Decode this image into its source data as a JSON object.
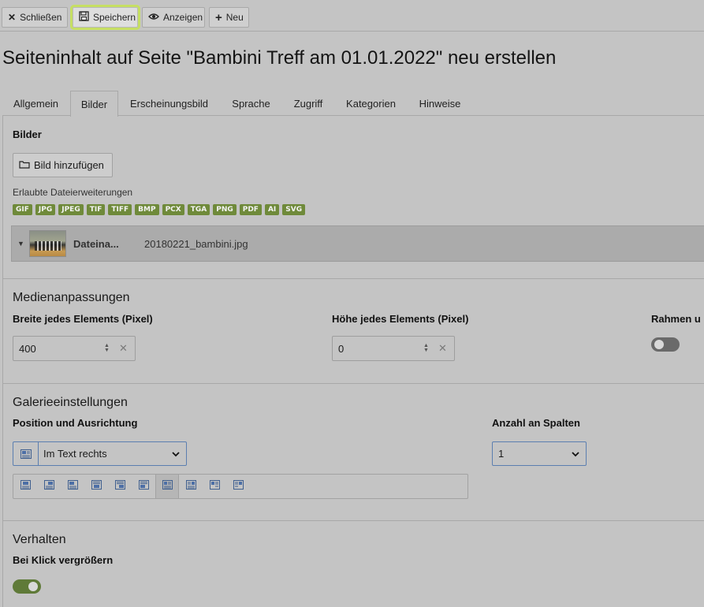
{
  "toolbar": {
    "close_label": "Schließen",
    "save_label": "Speichern",
    "view_label": "Anzeigen",
    "new_label": "Neu"
  },
  "page": {
    "title": "Seiteninhalt auf Seite \"Bambini Treff am 01.01.2022\" neu erstellen"
  },
  "tabs": [
    {
      "label": "Allgemein"
    },
    {
      "label": "Bilder"
    },
    {
      "label": "Erscheinungsbild"
    },
    {
      "label": "Sprache"
    },
    {
      "label": "Zugriff"
    },
    {
      "label": "Kategorien"
    },
    {
      "label": "Hinweise"
    }
  ],
  "active_tab": "Bilder",
  "images": {
    "heading": "Bilder",
    "add_button_label": "Bild hinzufügen",
    "allowed_label": "Erlaubte Dateierweiterungen",
    "extensions": [
      "GIF",
      "JPG",
      "JPEG",
      "TIF",
      "TIFF",
      "BMP",
      "PCX",
      "TGA",
      "PNG",
      "PDF",
      "AI",
      "SVG"
    ],
    "file": {
      "name_label": "Dateina...",
      "filename": "20180221_bambini.jpg"
    }
  },
  "media": {
    "heading": "Medienanpassungen",
    "width_label": "Breite jedes Elements (Pixel)",
    "width_value": "400",
    "height_label": "Höhe jedes Elements (Pixel)",
    "height_value": "0",
    "border_label": "Rahmen u",
    "border_enabled": false
  },
  "gallery": {
    "heading": "Galerieeinstellungen",
    "position_label": "Position und Ausrichtung",
    "position_value": "Im Text rechts",
    "columns_label": "Anzahl an Spalten",
    "columns_value": "1",
    "active_position_index": 6
  },
  "behaviour": {
    "heading": "Verhalten",
    "click_enlarge_label": "Bei Klick vergrößern",
    "click_enlarge_enabled": true
  },
  "colors": {
    "background": "#c4c4c4",
    "focus_outline": "#c6df63",
    "extension_badge": "#6f8a3a",
    "toggle_on": "#5f7a38",
    "toggle_off": "#6a6a6a",
    "select_border": "#5b7eb0"
  }
}
